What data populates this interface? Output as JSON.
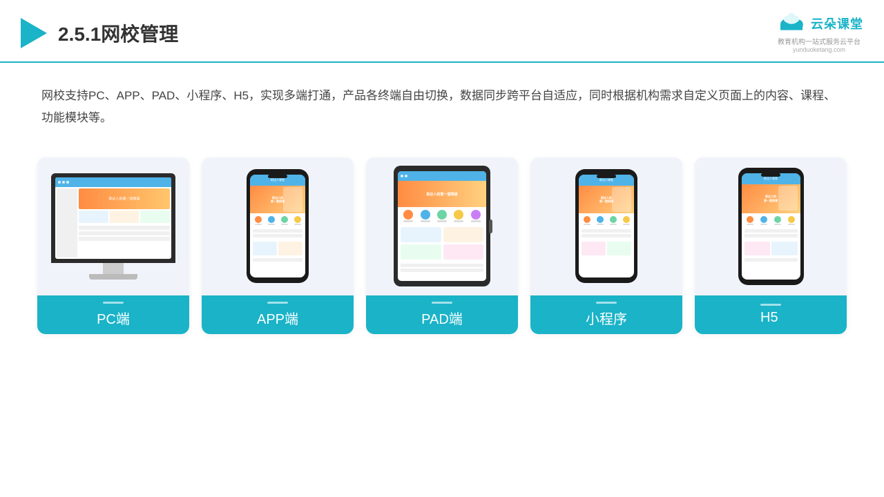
{
  "header": {
    "title": "2.5.1网校管理",
    "logo_name": "云朵课堂",
    "logo_url": "yunduoketang.com",
    "logo_subtitle": "教育机构一站式服务云平台"
  },
  "description": {
    "text": "网校支持PC、APP、PAD、小程序、H5，实现多端打通，产品各终端自由切换，数据同步跨平台自适应，同时根据机构需求自定义页面上的内容、课程、功能模块等。"
  },
  "cards": [
    {
      "id": "pc",
      "label": "PC端"
    },
    {
      "id": "app",
      "label": "APP端"
    },
    {
      "id": "pad",
      "label": "PAD端"
    },
    {
      "id": "miniprogram",
      "label": "小程序"
    },
    {
      "id": "h5",
      "label": "H5"
    }
  ]
}
